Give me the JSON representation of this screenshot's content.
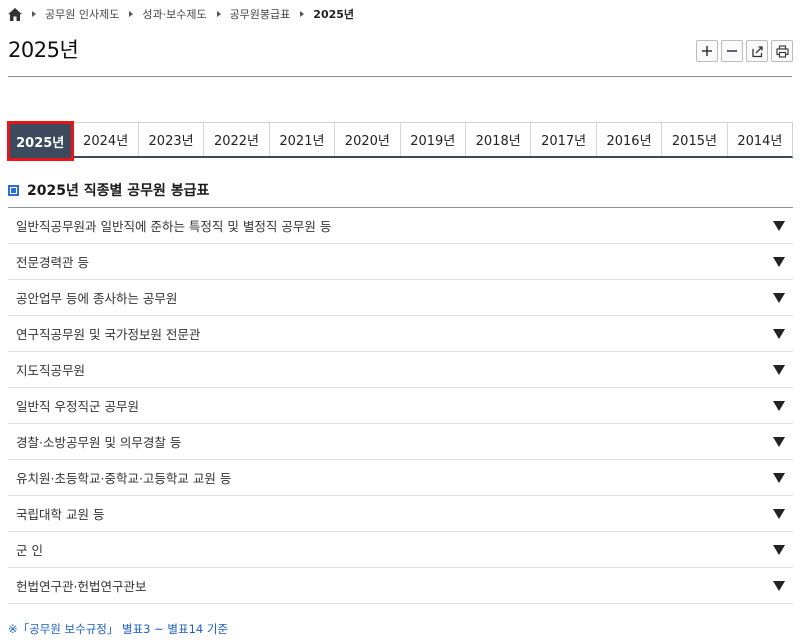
{
  "breadcrumb": {
    "items": [
      "공무원 인사제도",
      "성과·보수제도",
      "공무원봉급표"
    ],
    "current": "2025년"
  },
  "page": {
    "title": "2025년"
  },
  "tools": [
    "zoom-in",
    "zoom-out",
    "share",
    "print"
  ],
  "year_tabs": {
    "active": "2025년",
    "items": [
      "2025년",
      "2024년",
      "2023년",
      "2022년",
      "2021년",
      "2020년",
      "2019년",
      "2018년",
      "2017년",
      "2016년",
      "2015년",
      "2014년"
    ]
  },
  "section": {
    "title": "2025년 직종별 공무원 봉급표"
  },
  "accordion": {
    "items": [
      "일반직공무원과 일반직에 준하는 특정직 및 별정직 공무원 등",
      "전문경력관 등",
      "공안업무 등에 종사하는 공무원",
      "연구직공무원 및 국가정보원 전문관",
      "지도직공무원",
      "일반직 우정직군 공무원",
      "경찰·소방공무원 및 의무경찰 등",
      "유치원·초등학교·중학교·고등학교 교원 등",
      "국립대학 교원 등",
      "군 인",
      "헌법연구관·헌법연구관보"
    ]
  },
  "footnote": {
    "text": "※「공무원 보수규정」 별표3 ~ 별표14 기준"
  },
  "colors": {
    "active_tab": "#3b4a5c",
    "highlight": "#e8161b",
    "link": "#1d5fbf"
  }
}
